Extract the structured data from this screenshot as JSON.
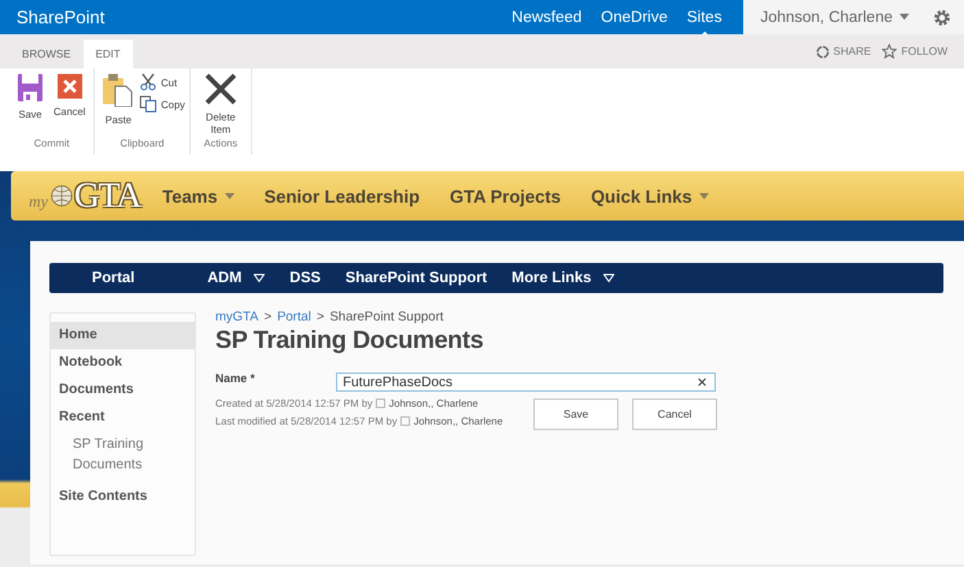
{
  "suite_bar": {
    "brand": "SharePoint",
    "links": [
      {
        "label": "Newsfeed",
        "selected": false
      },
      {
        "label": "OneDrive",
        "selected": false
      },
      {
        "label": "Sites",
        "selected": true
      }
    ],
    "user": "Johnson, Charlene"
  },
  "ribbon_tabs": [
    {
      "label": "BROWSE",
      "selected": false
    },
    {
      "label": "EDIT",
      "selected": true
    }
  ],
  "ribbon_actions": [
    "SHARE",
    "FOLLOW"
  ],
  "ribbon_groups": [
    {
      "label": "Commit",
      "commands": [
        {
          "label": "Save",
          "kind": "save"
        },
        {
          "label": "Cancel",
          "kind": "cancel"
        }
      ]
    },
    {
      "label": "Clipboard",
      "commands": [
        {
          "label": "Paste",
          "kind": "paste"
        },
        {
          "label": "Cut",
          "kind": "cut"
        },
        {
          "label": "Copy",
          "kind": "copy"
        }
      ]
    },
    {
      "label": "Actions",
      "commands": [
        {
          "label": "Delete Item",
          "kind": "delete"
        }
      ]
    }
  ],
  "logo": {
    "prefix": "my",
    "name": "GTA"
  },
  "top_nav": [
    {
      "label": "Teams",
      "has_menu": true
    },
    {
      "label": "Senior Leadership",
      "has_menu": false
    },
    {
      "label": "GTA Projects",
      "has_menu": false
    },
    {
      "label": "Quick Links",
      "has_menu": true
    }
  ],
  "site_nav": [
    {
      "label": "Portal",
      "has_menu": false
    },
    {
      "label": "ADM",
      "has_menu": true
    },
    {
      "label": "DSS",
      "has_menu": false
    },
    {
      "label": "SharePoint Support",
      "has_menu": false
    },
    {
      "label": "More Links",
      "has_menu": true
    }
  ],
  "sidebar": {
    "items": [
      {
        "label": "Home",
        "selected": true
      },
      {
        "label": "Notebook",
        "selected": false
      },
      {
        "label": "Documents",
        "selected": false
      },
      {
        "label": "Recent",
        "selected": false,
        "children": [
          {
            "label": "SP Training Documents",
            "selected": false
          }
        ]
      },
      {
        "label": "Site Contents",
        "selected": false
      }
    ]
  },
  "breadcrumb": [
    {
      "label": "myGTA",
      "link": true
    },
    {
      "separator": ">",
      "label": "Portal",
      "link": true
    },
    {
      "separator": ">",
      "label": "SharePoint Support",
      "link": false
    }
  ],
  "page_title": "SP Training Documents",
  "form": {
    "name_label": "Name *",
    "name_value": "FuturePhaseDocs",
    "created": {
      "text": "Created at 5/28/2014 12:57 PM  by",
      "user": "Johnson,, Charlene"
    },
    "modified": {
      "text": "Last modified at 5/28/2014 12:57 PM  by",
      "user": "Johnson,, Charlene"
    },
    "buttons": [
      "Save",
      "Cancel"
    ]
  }
}
